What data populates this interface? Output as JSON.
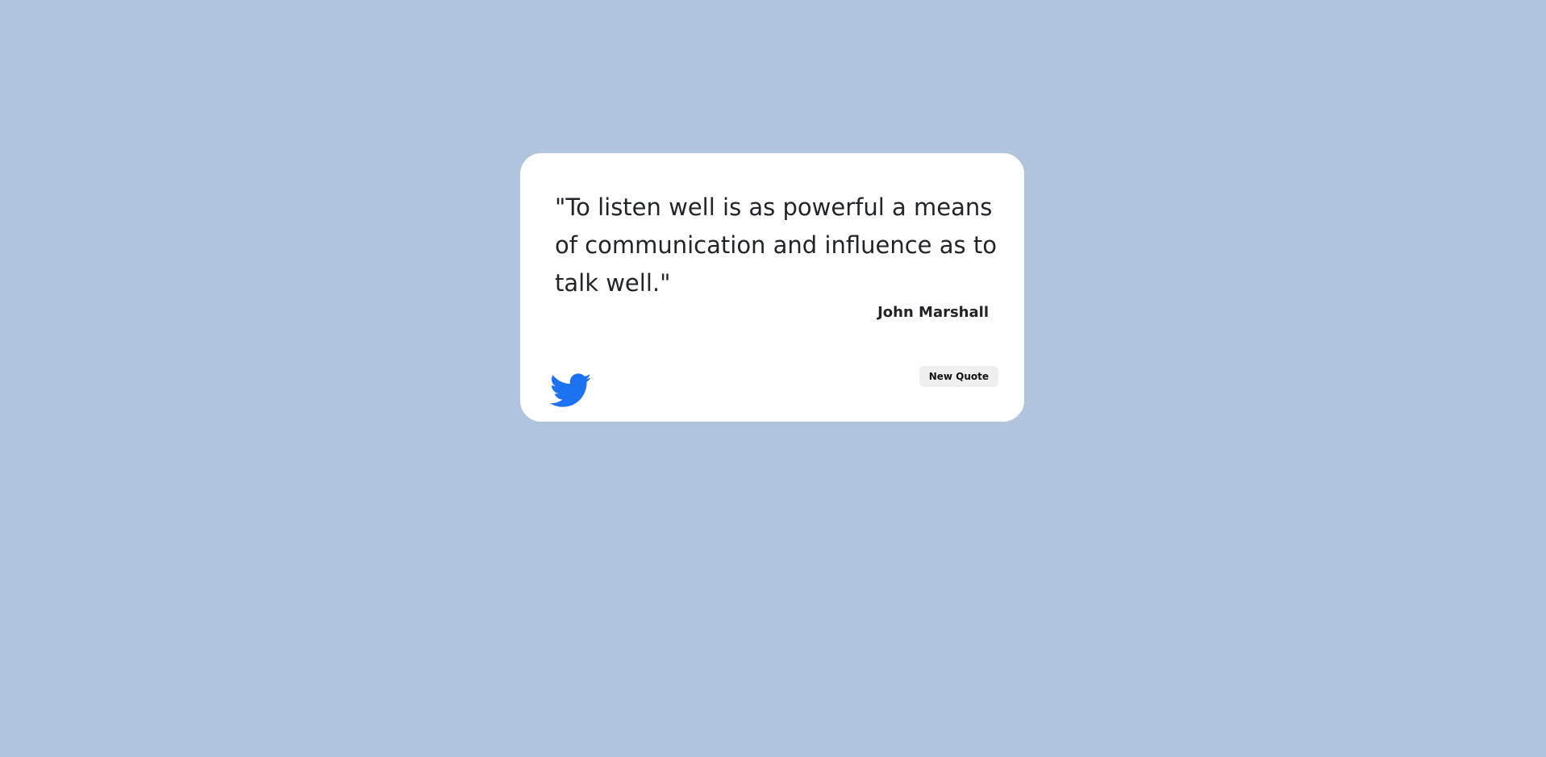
{
  "quote": {
    "text": "\"To listen well is as powerful a means of communication and influence as to talk well.\"",
    "author": "John Marshall"
  },
  "actions": {
    "tweet_icon": "twitter-bird-icon",
    "new_quote_label": "New Quote"
  },
  "colors": {
    "background": "#b0c4de",
    "card": "#ffffff",
    "text": "#212529",
    "twitter_blue": "#1d72f2",
    "button_bg": "#efefef"
  }
}
